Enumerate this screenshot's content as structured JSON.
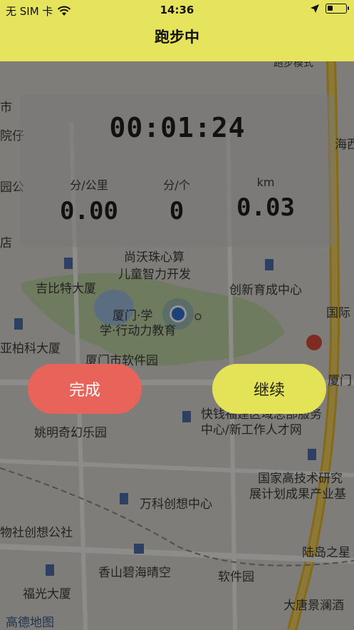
{
  "status_bar": {
    "carrier": "无 SIM 卡",
    "time": "14:36",
    "icons": [
      "wifi-icon",
      "location-arrow-icon",
      "battery-icon"
    ]
  },
  "nav": {
    "title": "跑步中"
  },
  "stats": {
    "elapsed": "00:01:24",
    "pace": {
      "unit": "分/公里",
      "value": "0.00"
    },
    "cadence": {
      "unit": "分/个",
      "value": "0"
    },
    "distance": {
      "unit": "km",
      "value": "0.03"
    }
  },
  "buttons": {
    "finish": "完成",
    "continue": "继续"
  },
  "map": {
    "labels": [
      "尚沃珠心算",
      "儿童智力开发",
      "吉比特大厦",
      "创新育成中心",
      "厦门·学",
      "学·行动力教育",
      "亚柏科大厦",
      "厦门市软件园",
      "姚明奇幻乐园",
      "快钱福建区域总部服务",
      "中心/新工作人才网",
      "国家高技术研究",
      "展计划成果产业基",
      "万科创想中心",
      "物社创想公社",
      "陆岛之星",
      "香山碧海晴空",
      "软件园",
      "福光大厦",
      "大唐景澜酒",
      "厦门",
      "国际",
      "跑步模式",
      "市",
      "院仔",
      "园公",
      "店",
      "海西",
      "高德地图"
    ]
  },
  "colors": {
    "nav_bg": "#e6e35d",
    "finish": "#e8635a",
    "continue": "#e4e257"
  }
}
